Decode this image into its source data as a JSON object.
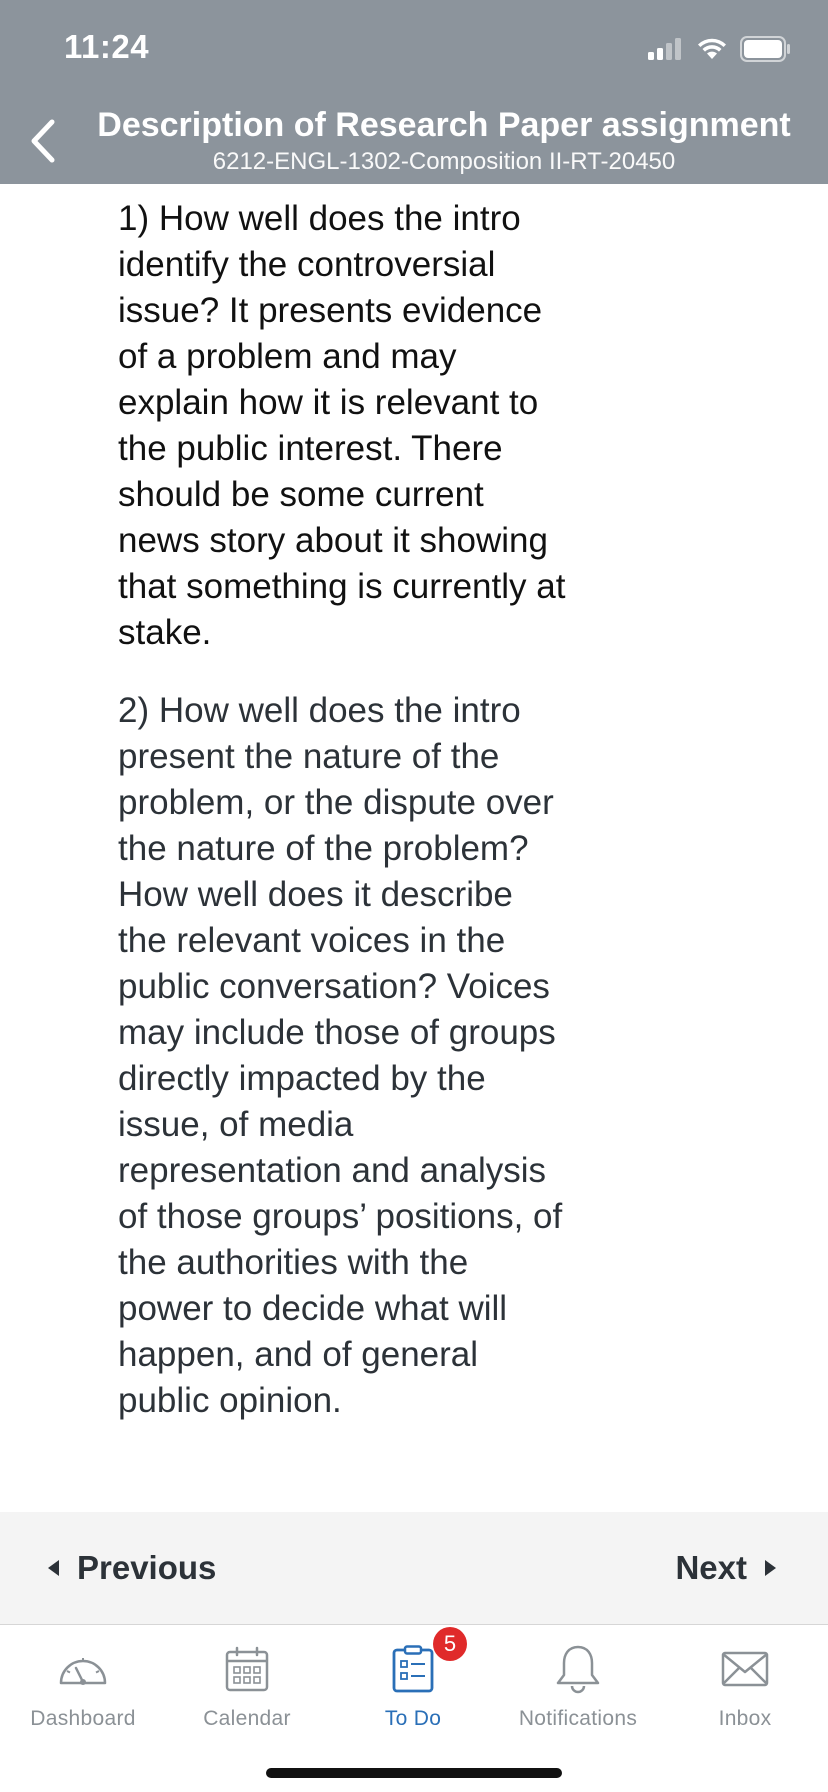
{
  "status_bar": {
    "time": "11:24"
  },
  "nav": {
    "title": "Description of Research Paper assignment",
    "subtitle": "6212-ENGL-1302-Composition II-RT-20450",
    "back_icon": "chevron-left-icon"
  },
  "content": {
    "paragraphs": [
      "1) How well does the intro identify the controversial issue? It presents evidence of a problem and may explain how it is relevant to the public interest. There should be some current news story about it showing that something is currently at stake.",
      "2) How well does the intro present the nature of the problem, or the dispute over the nature of the problem? How well does it describe the relevant voices in the public conversation? Voices may include those of groups directly impacted by the issue, of media representation and analysis of those groups’ positions, of the authorities with the power to decide what will happen, and of general public opinion."
    ]
  },
  "pager": {
    "previous_label": "Previous",
    "next_label": "Next"
  },
  "tabbar": {
    "tabs": [
      {
        "label": "Dashboard",
        "icon": "dashboard-gauge-icon",
        "active": false
      },
      {
        "label": "Calendar",
        "icon": "calendar-icon",
        "active": false
      },
      {
        "label": "To Do",
        "icon": "todo-clipboard-icon",
        "active": true,
        "badge": "5"
      },
      {
        "label": "Notifications",
        "icon": "bell-icon",
        "active": false
      },
      {
        "label": "Inbox",
        "icon": "envelope-icon",
        "active": false
      }
    ]
  },
  "colors": {
    "header_bg": "#8c949c",
    "active_tab": "#2a6fb7",
    "inactive_tab": "#8b9196",
    "badge": "#e02a2a"
  }
}
